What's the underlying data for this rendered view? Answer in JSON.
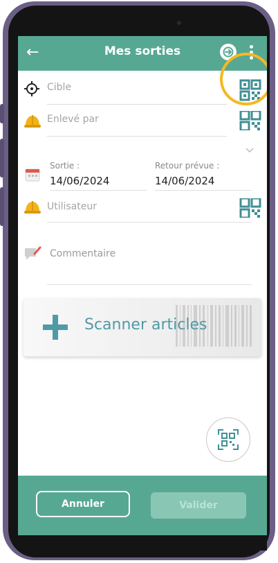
{
  "header": {
    "title": "Mes sorties",
    "back_icon": "back-arrow-icon",
    "sync_icon": "sync-icon",
    "menu_icon": "kebab-menu-icon"
  },
  "form": {
    "target_placeholder": "Cible",
    "removed_by_placeholder": "Enlevé par",
    "exit_label": "Sortie :",
    "exit_date": "14/06/2024",
    "return_label": "Retour prévue :",
    "return_date": "14/06/2024",
    "user_placeholder": "Utilisateur",
    "comment_placeholder": "Commentaire"
  },
  "scanner": {
    "label": "Scanner articles"
  },
  "footer": {
    "cancel_label": "Annuler",
    "validate_label": "Valider"
  },
  "colors": {
    "accent": "#57a893",
    "highlight": "#f5b823",
    "scanner_text": "#4f9aa7"
  }
}
